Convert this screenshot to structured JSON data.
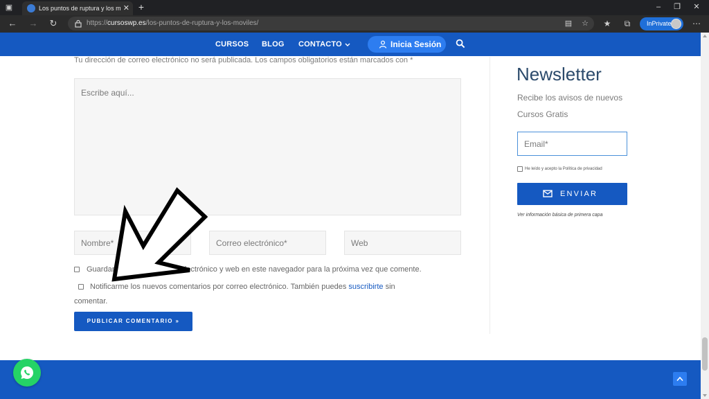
{
  "browser": {
    "tab_title": "Los puntos de ruptura y los móviles",
    "tab_close_icon": "close-icon",
    "new_tab_icon": "plus-icon",
    "url_scheme": "https://",
    "url_host": "cursoswp.es",
    "url_path": "/los-puntos-de-ruptura-y-los-moviles/",
    "inprivate_label": "InPrivate",
    "accent": "#1f6fd8"
  },
  "site_nav": {
    "items": [
      {
        "label": "CURSOS"
      },
      {
        "label": "BLOG"
      },
      {
        "label": "CONTACTO"
      }
    ],
    "login_label": "Inicia Sesión",
    "brand_color": "#1559c1"
  },
  "comment_form": {
    "notice": "Tu dirección de correo electrónico no será publicada. Los campos obligatorios están marcados con *",
    "comment_placeholder": "Escribe aquí...",
    "name_placeholder": "Nombre*",
    "email_placeholder": "Correo electrónico*",
    "web_placeholder": "Web",
    "save_label": "Guardar mi nombre, correo electrónico y web en este navegador para la próxima vez que comente.",
    "notify_label": "Notificarme los nuevos comentarios por correo electrónico. También puedes",
    "subscribe_link": "suscribirte",
    "notify_tail": "sin",
    "notify_line2": "comentar.",
    "submit_label": "PUBLICAR COMENTARIO »"
  },
  "newsletter": {
    "title": "Newsletter",
    "description": "Recibe los avisos de nuevos Cursos Gratis",
    "email_placeholder": "Email*",
    "privacy_label": "He leído y acepto la Política de privacidad",
    "send_label": "ENVIAR",
    "info_text": "Ver información básica de primera capa"
  }
}
